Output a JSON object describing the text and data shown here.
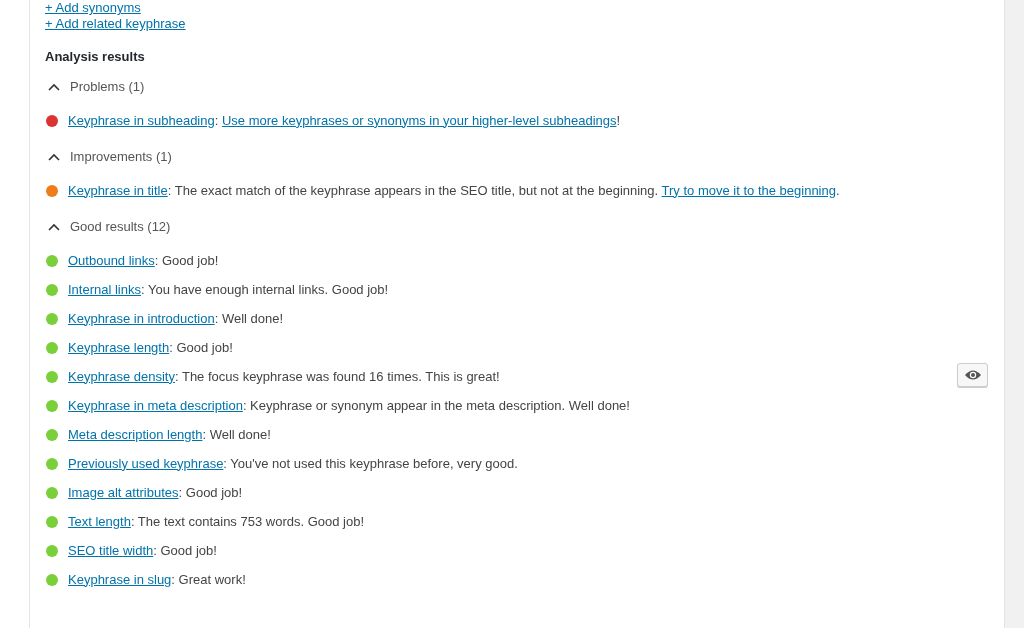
{
  "links": [
    "+ Add synonyms",
    "+ Add related keyphrase"
  ],
  "heading": "Analysis results",
  "sections": [
    {
      "label": "Problems (1)",
      "expanded": true,
      "results": [
        {
          "color": "#dc3232",
          "marker": false,
          "parts": [
            {
              "kind": "link",
              "text": "Keyphrase in subheading"
            },
            {
              "kind": "text",
              "text": ": "
            },
            {
              "kind": "link",
              "text": "Use more keyphrases or synonyms in your higher-level subheadings"
            },
            {
              "kind": "text",
              "text": "!"
            }
          ]
        }
      ]
    },
    {
      "label": "Improvements (1)",
      "expanded": true,
      "results": [
        {
          "color": "#ee7c1b",
          "marker": false,
          "parts": [
            {
              "kind": "link",
              "text": "Keyphrase in title"
            },
            {
              "kind": "text",
              "text": ": The exact match of the keyphrase appears in the SEO title, but not at the beginning. "
            },
            {
              "kind": "link",
              "text": "Try to move it to the beginning"
            },
            {
              "kind": "text",
              "text": "."
            }
          ]
        }
      ]
    },
    {
      "label": "Good results (12)",
      "expanded": true,
      "results": [
        {
          "color": "#7ad03a",
          "marker": false,
          "parts": [
            {
              "kind": "link",
              "text": "Outbound links"
            },
            {
              "kind": "text",
              "text": ": Good job!"
            }
          ]
        },
        {
          "color": "#7ad03a",
          "marker": false,
          "parts": [
            {
              "kind": "link",
              "text": "Internal links"
            },
            {
              "kind": "text",
              "text": ": You have enough internal links. Good job!"
            }
          ]
        },
        {
          "color": "#7ad03a",
          "marker": false,
          "parts": [
            {
              "kind": "link",
              "text": "Keyphrase in introduction"
            },
            {
              "kind": "text",
              "text": ": Well done!"
            }
          ]
        },
        {
          "color": "#7ad03a",
          "marker": false,
          "parts": [
            {
              "kind": "link",
              "text": "Keyphrase length"
            },
            {
              "kind": "text",
              "text": ": Good job!"
            }
          ]
        },
        {
          "color": "#7ad03a",
          "marker": true,
          "parts": [
            {
              "kind": "link",
              "text": "Keyphrase density"
            },
            {
              "kind": "text",
              "text": ": The focus keyphrase was found 16 times. This is great!"
            }
          ]
        },
        {
          "color": "#7ad03a",
          "marker": false,
          "parts": [
            {
              "kind": "link",
              "text": "Keyphrase in meta description"
            },
            {
              "kind": "text",
              "text": ": Keyphrase or synonym appear in the meta description. Well done!"
            }
          ]
        },
        {
          "color": "#7ad03a",
          "marker": false,
          "parts": [
            {
              "kind": "link",
              "text": "Meta description length"
            },
            {
              "kind": "text",
              "text": ": Well done!"
            }
          ]
        },
        {
          "color": "#7ad03a",
          "marker": false,
          "parts": [
            {
              "kind": "link",
              "text": "Previously used keyphrase"
            },
            {
              "kind": "text",
              "text": ": You've not used this keyphrase before, very good."
            }
          ]
        },
        {
          "color": "#7ad03a",
          "marker": false,
          "parts": [
            {
              "kind": "link",
              "text": "Image alt attributes"
            },
            {
              "kind": "text",
              "text": ": Good job!"
            }
          ]
        },
        {
          "color": "#7ad03a",
          "marker": false,
          "parts": [
            {
              "kind": "link",
              "text": "Text length"
            },
            {
              "kind": "text",
              "text": ": The text contains 753 words. Good job!"
            }
          ]
        },
        {
          "color": "#7ad03a",
          "marker": false,
          "parts": [
            {
              "kind": "link",
              "text": "SEO title width"
            },
            {
              "kind": "text",
              "text": ": Good job!"
            }
          ]
        },
        {
          "color": "#7ad03a",
          "marker": false,
          "parts": [
            {
              "kind": "link",
              "text": "Keyphrase in slug"
            },
            {
              "kind": "text",
              "text": ": Great work!"
            }
          ]
        }
      ]
    }
  ]
}
